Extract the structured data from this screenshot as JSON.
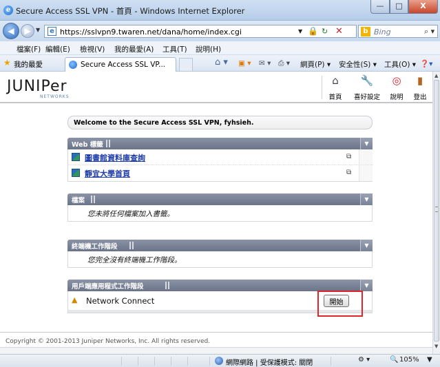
{
  "window": {
    "title": "Secure Access SSL VPN - 首頁 - Windows Internet Explorer",
    "min": "—",
    "max": "□",
    "close": "X"
  },
  "address": {
    "url": "https://sslvpn9.twaren.net/dana/home/index.cgi",
    "search_placeholder": "Bing"
  },
  "menu": [
    "檔案(F)",
    "編輯(E)",
    "檢視(V)",
    "我的最愛(A)",
    "工具(T)",
    "說明(H)"
  ],
  "favorites": {
    "label": "我的最愛",
    "tab_label": "Secure Access SSL VP...",
    "page_menu": "網頁(P) ▾",
    "safety_menu": "安全性(S) ▾",
    "tools_menu": "工具(O) ▾"
  },
  "header": {
    "logo": "JUNIPer",
    "logo_sub": "NETWORKS",
    "tools": [
      {
        "label": "首頁"
      },
      {
        "label": "喜好設定"
      },
      {
        "label": "說明"
      },
      {
        "label": "登出"
      }
    ]
  },
  "welcome": "Welcome to the Secure Access SSL VPN, fyhsieh.",
  "panels": {
    "web": {
      "title": "Web 標籤",
      "items": [
        {
          "label": "圖書館資料庫查詢"
        },
        {
          "label": "靜宜大學首頁"
        }
      ]
    },
    "files": {
      "title": "檔案",
      "empty": "您未將任何檔案加入書籤。"
    },
    "terminal": {
      "title": "終端機工作階段",
      "empty": "您完全沒有終端機工作階段。"
    },
    "client_apps": {
      "title": "用戶端應用程式工作階段",
      "item": "Network Connect",
      "start_button": "開始"
    }
  },
  "copyright": "Copyright © 2001-2013 Juniper Networks, Inc. All rights reserved.",
  "status": {
    "zone": "網際網路 | 受保護模式: 關閉",
    "zoom": "105%"
  },
  "colors": {
    "panel_header": "#7a8297",
    "link": "#1f3da8",
    "highlight": "#e0242c"
  }
}
